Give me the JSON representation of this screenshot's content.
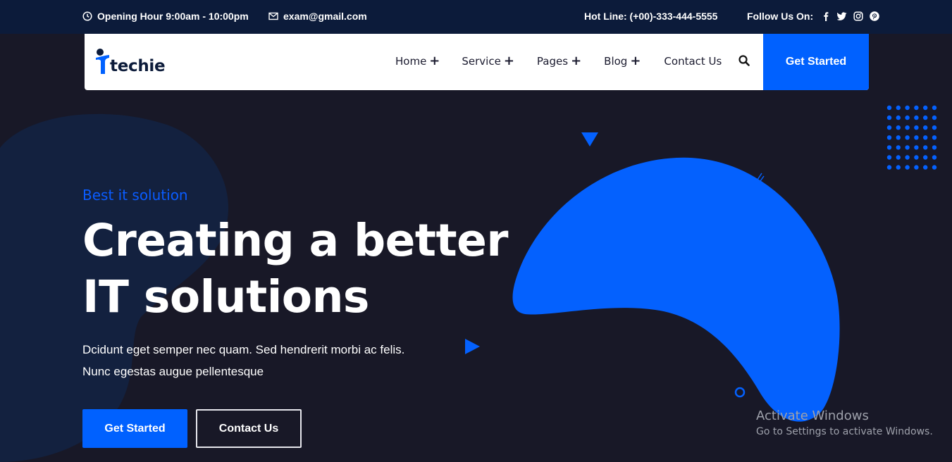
{
  "topbar": {
    "opening_hours": "Opening Hour 9:00am - 10:00pm",
    "email": "exam@gmail.com",
    "hotline": "Hot Line: (+00)-333-444-5555",
    "follow_label": "Follow Us On:",
    "social_icons": [
      "facebook-icon",
      "twitter-icon",
      "instagram-icon",
      "pinterest-icon"
    ]
  },
  "nav": {
    "logo_text": "techie",
    "items": [
      {
        "label": "Home",
        "has_submenu": true
      },
      {
        "label": "Service",
        "has_submenu": true
      },
      {
        "label": "Pages",
        "has_submenu": true
      },
      {
        "label": "Blog",
        "has_submenu": true
      },
      {
        "label": "Contact Us",
        "has_submenu": false
      }
    ],
    "submenu_indicator": "+",
    "cta_label": "Get Started"
  },
  "hero": {
    "subtitle": "Best it solution",
    "headline_line1": "Creating a better",
    "headline_line2": "IT solutions",
    "desc_line1": "Dcidunt eget semper nec quam. Sed hendrerit morbi ac felis.",
    "desc_line2": "Nunc egestas augue pellentesque",
    "primary_button": "Get Started",
    "secondary_button": "Contact Us"
  },
  "watermark": {
    "title": "Activate Windows",
    "subtitle": "Go to Settings to activate Windows."
  },
  "colors": {
    "accent": "#0061ff",
    "topbar_bg": "#0c1b3a",
    "hero_bg": "#181827",
    "decor_blob": "#13213f"
  }
}
